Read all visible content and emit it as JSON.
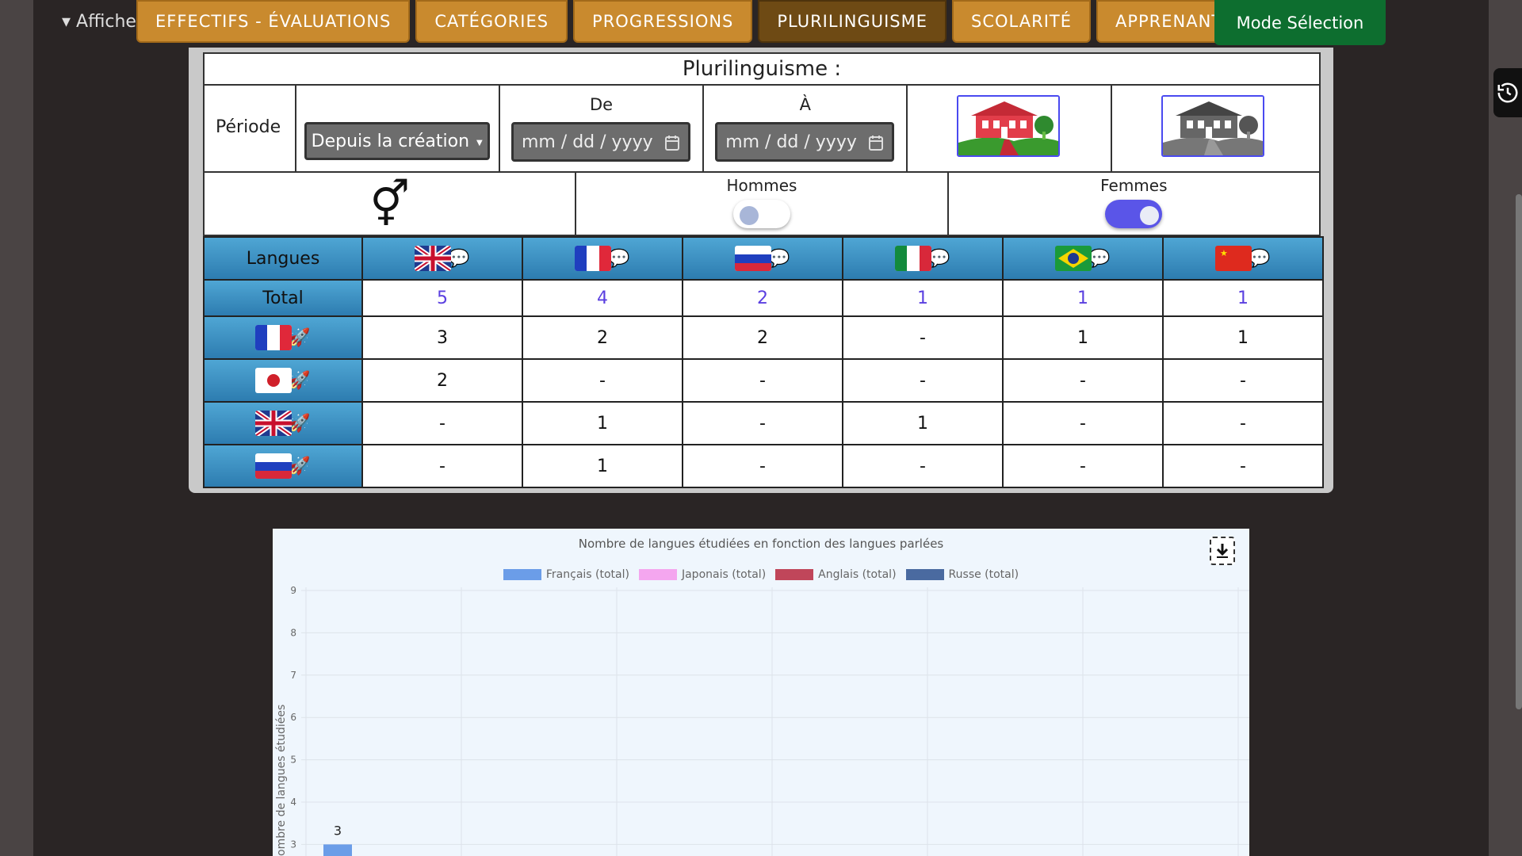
{
  "header": {
    "afficher_label": "▾ Affiche",
    "mode_label": "Mode Sélection"
  },
  "tabs": [
    {
      "label": "EFFECTIFS - ÉVALUATIONS",
      "active": false
    },
    {
      "label": "CATÉGORIES",
      "active": false
    },
    {
      "label": "PROGRESSIONS",
      "active": false
    },
    {
      "label": "PLURILINGUISME",
      "active": true
    },
    {
      "label": "SCOLARITÉ",
      "active": false
    },
    {
      "label": "APPRENANTS",
      "active": false
    }
  ],
  "panel": {
    "title": "Plurilinguisme :",
    "periode_label": "Période",
    "periode_value": "Depuis la création",
    "de_label": "De",
    "a_label": "À",
    "date_placeholder": "mm / dd / yyyy",
    "gender_symbol": "⚥",
    "hommes_label": "Hommes",
    "femmes_label": "Femmes",
    "hommes_on": false,
    "femmes_on": true
  },
  "table": {
    "langues_label": "Langues",
    "total_label": "Total",
    "studied_languages": [
      "gb",
      "fr",
      "ru",
      "it",
      "br",
      "cn"
    ],
    "totals": [
      "5",
      "4",
      "2",
      "1",
      "1",
      "1"
    ],
    "rows": [
      {
        "spoken": "fr",
        "values": [
          "3",
          "2",
          "2",
          "-",
          "1",
          "1"
        ]
      },
      {
        "spoken": "jp",
        "values": [
          "2",
          "-",
          "-",
          "-",
          "-",
          "-"
        ]
      },
      {
        "spoken": "gb",
        "values": [
          "-",
          "1",
          "-",
          "1",
          "-",
          "-"
        ]
      },
      {
        "spoken": "ru",
        "values": [
          "-",
          "1",
          "-",
          "-",
          "-",
          "-"
        ]
      }
    ]
  },
  "colors": {
    "tab": "#c98a2e",
    "tab_active": "#6e4a14",
    "mode": "#0d6e2f",
    "total_text": "#5a3fe0"
  },
  "chart_data": {
    "type": "bar",
    "title": "Nombre de langues étudiées en fonction des langues parlées",
    "ylabel": "ombre de langues étudiées",
    "ylim": [
      0,
      9
    ],
    "y_ticks": [
      "9",
      "8",
      "7",
      "6",
      "5",
      "4",
      "3"
    ],
    "series": [
      {
        "name": "Français (total)",
        "color": "#6b9de8",
        "values": [
          3
        ]
      },
      {
        "name": "Japonais (total)",
        "color": "#f4a6ef",
        "values": []
      },
      {
        "name": "Anglais (total)",
        "color": "#c0465a",
        "values": []
      },
      {
        "name": "Russe (total)",
        "color": "#4a6aa0",
        "values": []
      }
    ]
  }
}
